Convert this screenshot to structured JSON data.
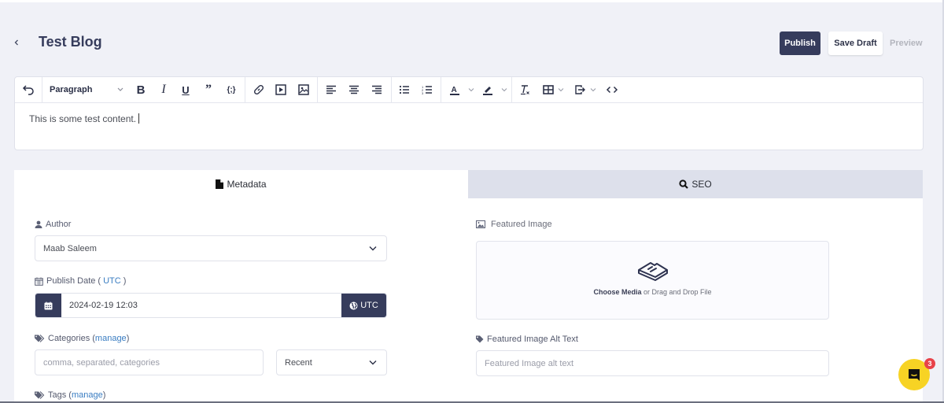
{
  "header": {
    "title": "Test Blog",
    "back_icon": "chevron-left-icon",
    "publish_label": "Publish",
    "save_draft_label": "Save Draft",
    "preview_label": "Preview"
  },
  "editor": {
    "toolbar": {
      "undo": "undo-icon",
      "block_format": "Paragraph",
      "buttons": [
        "bold",
        "italic",
        "underline",
        "blockquote",
        "code",
        "link",
        "media",
        "image",
        "align-left",
        "align-center",
        "align-right",
        "bullet-list",
        "numbered-list",
        "text-color",
        "highlight",
        "clear-formatting",
        "table",
        "export",
        "source-code"
      ]
    },
    "content": "This is some test content."
  },
  "tabs": [
    {
      "label": "Metadata",
      "icon": "file-icon",
      "active": true
    },
    {
      "label": "SEO",
      "icon": "search-icon",
      "active": false
    }
  ],
  "metadata": {
    "author": {
      "label": "Author",
      "value": "Maab Saleem"
    },
    "publish_date": {
      "label": "Publish Date (",
      "tz_link": "UTC",
      "label_end": ")",
      "value": "2024-02-19 12:03",
      "tz_button": "UTC"
    },
    "categories": {
      "label": "Categories (",
      "link": "manage",
      "label_end": ")",
      "placeholder": "comma, separated, categories",
      "sort_value": "Recent"
    },
    "tags": {
      "label": "Tags (",
      "link": "manage",
      "label_end": ")"
    },
    "featured_image": {
      "label": "Featured Image",
      "choose_label": "Choose Media",
      "drop_text": " or Drag and Drop File"
    },
    "alt_text": {
      "label": "Featured Image Alt Text",
      "placeholder": "Featured Image alt text"
    }
  },
  "chat": {
    "badge_count": "3"
  },
  "colors": {
    "primary": "#363c5c",
    "link": "#3a7dc2",
    "tab_inactive": "#dde0eb",
    "chat": "#f7d324",
    "badge": "#e8434a"
  }
}
